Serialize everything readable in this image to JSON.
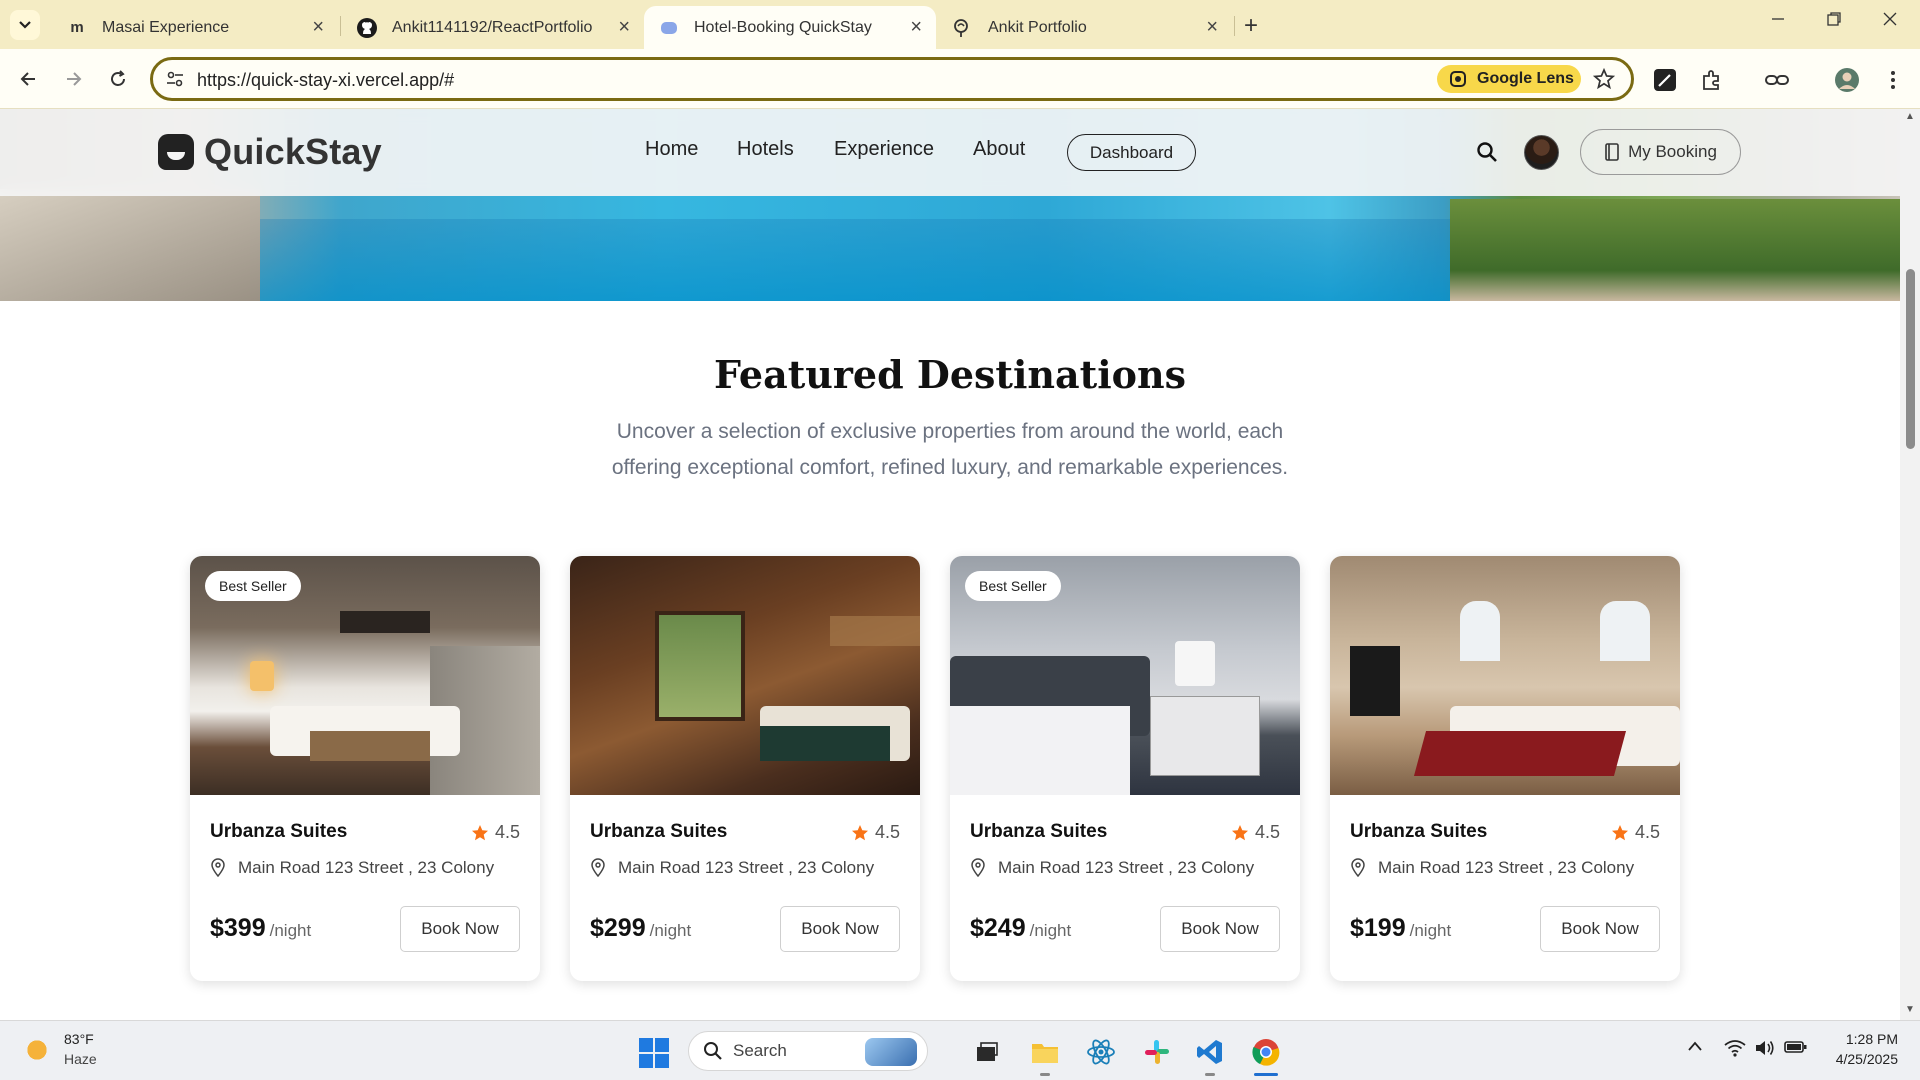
{
  "browser": {
    "tabs": [
      {
        "title": "Masai Experience",
        "favicon": "m"
      },
      {
        "title": "Ankit1141192/ReactPortfolio",
        "favicon": "github-icon"
      },
      {
        "title": "Hotel-Booking QuickStay",
        "favicon": "globe-icon"
      },
      {
        "title": "Ankit Portfolio",
        "favicon": "brain-icon"
      }
    ],
    "url": "https://quick-stay-xi.vercel.app/#",
    "lens_label": "Google Lens"
  },
  "site": {
    "brand": "QuickStay",
    "nav": [
      "Home",
      "Hotels",
      "Experience",
      "About"
    ],
    "dashboard_label": "Dashboard",
    "my_booking_label": "My Booking"
  },
  "featured": {
    "title": "Featured Destinations",
    "subtitle": "Uncover a selection of exclusive properties from around the world, each offering exceptional comfort, refined luxury, and remarkable experiences.",
    "cards": [
      {
        "badge": "Best Seller",
        "name": "Urbanza Suites",
        "rating": "4.5",
        "address": "Main Road 123 Street , 23 Colony",
        "price": "$399",
        "per": "/night",
        "cta": "Book Now"
      },
      {
        "badge": "",
        "name": "Urbanza Suites",
        "rating": "4.5",
        "address": "Main Road 123 Street , 23 Colony",
        "price": "$299",
        "per": "/night",
        "cta": "Book Now"
      },
      {
        "badge": "Best Seller",
        "name": "Urbanza Suites",
        "rating": "4.5",
        "address": "Main Road 123 Street , 23 Colony",
        "price": "$249",
        "per": "/night",
        "cta": "Book Now"
      },
      {
        "badge": "",
        "name": "Urbanza Suites",
        "rating": "4.5",
        "address": "Main Road 123 Street , 23 Colony",
        "price": "$199",
        "per": "/night",
        "cta": "Book Now"
      }
    ]
  },
  "taskbar": {
    "weather_temp": "83°F",
    "weather_cond": "Haze",
    "search_label": "Search",
    "time": "1:28 PM",
    "date": "4/25/2025"
  },
  "colors": {
    "accent_star": "#f97316",
    "chrome_tab_bg": "#f4ecc4",
    "lens_bg": "#f8d84a"
  }
}
